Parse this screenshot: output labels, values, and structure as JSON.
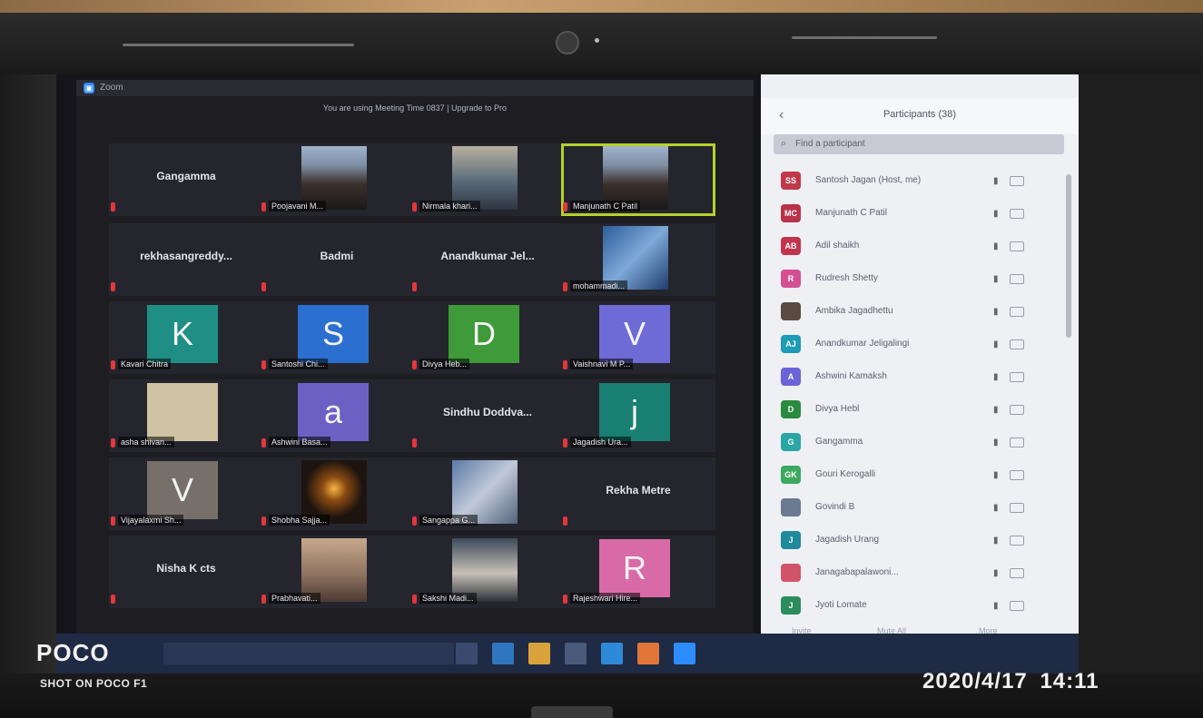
{
  "zoom": {
    "title": "Zoom",
    "banner": "You are using Meeting Time 0837 | Upgrade to Pro"
  },
  "tiles": [
    {
      "kind": "name",
      "text": "Gangamma"
    },
    {
      "kind": "video",
      "label": "Poojavani M...",
      "cam": "cam-face"
    },
    {
      "kind": "video",
      "label": "Nirmala khari...",
      "cam": "cam-room"
    },
    {
      "kind": "video",
      "label": "Manjunath C Patil",
      "cam": "cam-face",
      "featured": true
    },
    {
      "kind": "name",
      "text": "rekhasangreddy..."
    },
    {
      "kind": "name",
      "text": "Badmi"
    },
    {
      "kind": "name",
      "text": "Anandkumar Jel..."
    },
    {
      "kind": "video",
      "label": "mohammadi...",
      "cam": "cam-blue"
    },
    {
      "kind": "avatar",
      "letter": "K",
      "color": "#1f8f85",
      "label": "Kavari Chitra"
    },
    {
      "kind": "avatar",
      "letter": "S",
      "color": "#2b6fd0",
      "label": "Santoshi Chi..."
    },
    {
      "kind": "avatar",
      "letter": "D",
      "color": "#3f9a3a",
      "label": "Divya Heb..."
    },
    {
      "kind": "avatar",
      "letter": "V",
      "color": "#6e6ad6",
      "label": "Vaishnavi M P..."
    },
    {
      "kind": "avatar",
      "letter": "",
      "color": "#cfc3a3",
      "label": "asha shivan..."
    },
    {
      "kind": "avatar",
      "letter": "a",
      "color": "#6d60c4",
      "label": "Ashwini Basa..."
    },
    {
      "kind": "name",
      "text": "Sindhu Doddva..."
    },
    {
      "kind": "avatar",
      "letter": "j",
      "color": "#197f72",
      "label": "Jagadish Ura..."
    },
    {
      "kind": "avatar",
      "letter": "V",
      "color": "#77706a",
      "label": "Vijayalaxmi Sh..."
    },
    {
      "kind": "video",
      "label": "Shobha Sajja...",
      "cam": "cam-fire"
    },
    {
      "kind": "video",
      "label": "Sangappa G...",
      "cam": "cam-hand"
    },
    {
      "kind": "name",
      "text": "Rekha Metre"
    },
    {
      "kind": "name",
      "text": "Nisha K cts"
    },
    {
      "kind": "video",
      "label": "Prabhavati...",
      "cam": "cam-portrait"
    },
    {
      "kind": "video",
      "label": "Sakshi Madi...",
      "cam": "cam-girl"
    },
    {
      "kind": "avatar",
      "letter": "R",
      "color": "#d96aa8",
      "label": "Rajeshwari Hire..."
    }
  ],
  "participants": {
    "title": "Participants (38)",
    "find_placeholder": "Find a participant",
    "list": [
      {
        "initials": "SS",
        "color": "#c0394b",
        "name": "Santosh Jagan (Host, me)"
      },
      {
        "initials": "MC",
        "color": "#b8324a",
        "name": "Manjunath C Patil"
      },
      {
        "initials": "AB",
        "color": "#c2344d",
        "name": "Adil shaikh"
      },
      {
        "initials": "R",
        "color": "#d34f92",
        "name": "Rudresh Shetty"
      },
      {
        "initials": "",
        "color": "#5a4a40",
        "name": "Ambika Jagadhettu"
      },
      {
        "initials": "AJ",
        "color": "#1e9bb7",
        "name": "Anandkumar Jeligalingi"
      },
      {
        "initials": "A",
        "color": "#6d63d8",
        "name": "Ashwini Kamaksh"
      },
      {
        "initials": "D",
        "color": "#2a8a3d",
        "name": "Divya Hebl"
      },
      {
        "initials": "G",
        "color": "#2aa7a5",
        "name": "Gangamma"
      },
      {
        "initials": "GK",
        "color": "#3da85f",
        "name": "Gouri Kerogalli"
      },
      {
        "initials": "",
        "color": "#6b7a93",
        "name": "Govindi B"
      },
      {
        "initials": "J",
        "color": "#1e8a9b",
        "name": "Jagadish Urang"
      },
      {
        "initials": "",
        "color": "#d0536a",
        "name": "Janagabapalawoni..."
      },
      {
        "initials": "J",
        "color": "#2a8d5b",
        "name": "Jyoti Lomate"
      }
    ],
    "footer": [
      "Invite",
      "Mute All",
      "More"
    ]
  },
  "photo": {
    "brand": "POCO",
    "shot_on": "SHOT ON POCO F1",
    "timestamp": "2020/4/17  14:11"
  }
}
